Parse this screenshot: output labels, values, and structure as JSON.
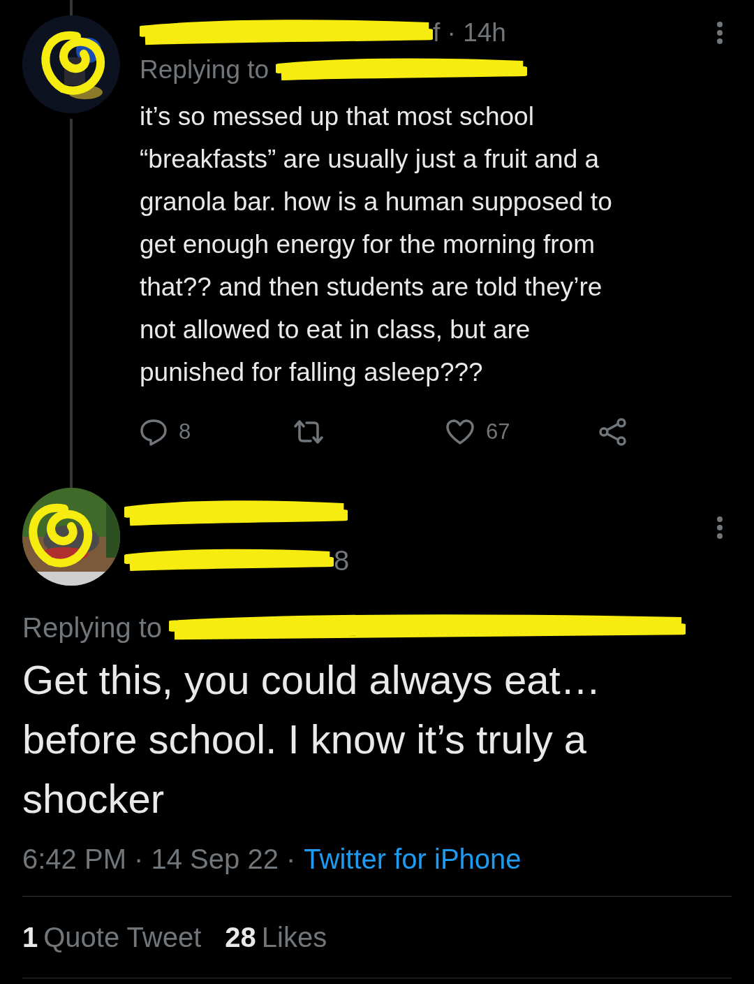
{
  "parent": {
    "meta": "f · 14h",
    "replying_label": "Replying to",
    "text": "it’s so messed up that most school\n“breakfasts” are usually just a fruit and a\ngranola bar. how is a human supposed to\nget enough energy for the morning from\nthat?? and then students are told they’re\nnot allowed to eat in class, but are\npunished for falling asleep???",
    "actions": [
      {
        "kind": "reply",
        "count": "8"
      },
      {
        "kind": "retweet"
      },
      {
        "kind": "like",
        "count": "67"
      },
      {
        "kind": "share"
      }
    ]
  },
  "main": {
    "handle_tail": "8",
    "replying_label": "Replying to",
    "text": "Get this, you could always eat…\nbefore school. I know it’s truly a\nshocker",
    "time": "6:42 PM · 14 Sep 22 ·",
    "source": "Twitter for iPhone",
    "stats": [
      {
        "count": "1",
        "label": "Quote Tweet"
      },
      {
        "count": "28",
        "label": "Likes"
      }
    ]
  }
}
